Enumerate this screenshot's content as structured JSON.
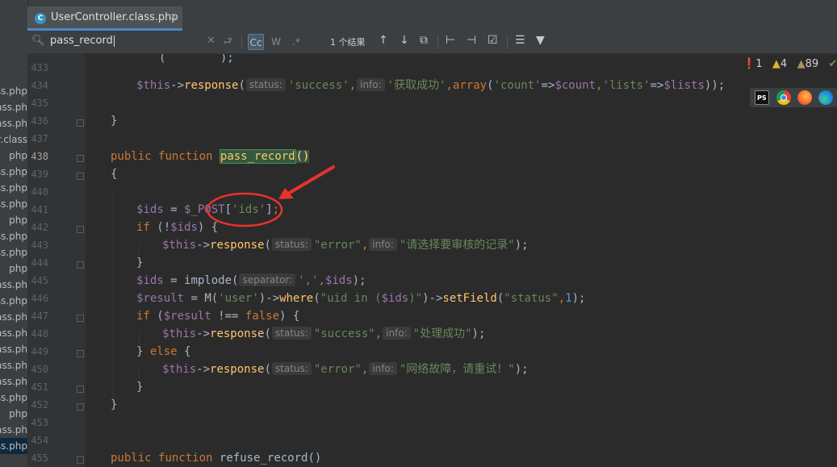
{
  "tab": {
    "title": "UserController.class.php",
    "close": "✕",
    "icon_letter": "C"
  },
  "left_panel": {
    "files": [
      "ass.php",
      "class.ph",
      "class.ph",
      "er.class",
      "php",
      "ass.php",
      "ass.php",
      "ass.php",
      "php",
      "ass.php",
      "ass.php",
      "php",
      "class.ph",
      "ass.php",
      "class.ph",
      "class.ph",
      "class.ph",
      "ass.ph",
      "class.ph",
      "ass.php",
      "php",
      "class.ph",
      "ass.php"
    ]
  },
  "search": {
    "query": "pass_record",
    "match_case": "Cc",
    "words": "W",
    "regex": ".*",
    "result_count": "1 个结果"
  },
  "inspections": {
    "errors": "1",
    "warnings": "4",
    "weak_warnings": "89",
    "icon_error": "❗",
    "icon_warn": "▲"
  },
  "browser_icons": [
    "phpstorm-icon",
    "chrome-icon",
    "firefox-icon",
    "edge-icon"
  ],
  "line_numbers": [
    "433",
    "434",
    "435",
    "436",
    "437",
    "438",
    "439",
    "440",
    "441",
    "442",
    "443",
    "444",
    "445",
    "446",
    "447",
    "448",
    "449",
    "450",
    "451",
    "452",
    "453",
    "454",
    "455"
  ],
  "code": {
    "l434": {
      "this": "$this",
      "arrow": "->",
      "fn": "response",
      "p1": "(",
      "hint1": "status:",
      "s1": "'success'",
      "c1": ",",
      "hint2": "info:",
      "s2": "'获取成功'",
      "c2": ",",
      "arr": "array",
      "p2": "(",
      "s3": "'count'",
      "op1": "=>",
      "v1": "$count",
      "c3": ",",
      "s4": "'lists'",
      "op2": "=>",
      "v2": "$lists",
      "end": "));"
    },
    "l436": {
      "brace": "}"
    },
    "l438": {
      "kw1": "public",
      "kw2": "function",
      "fn": "pass_record",
      "parens": "()"
    },
    "l439": {
      "brace": "{"
    },
    "l441": {
      "v1": "$ids",
      "eq": " = ",
      "v2": "$_POST",
      "b1": "[",
      "s1": "'ids'",
      "b2": "]",
      "semi": ";"
    },
    "l442": {
      "kw": "if",
      "p1": " (!",
      "v": "$ids",
      "p2": ") {"
    },
    "l443": {
      "this": "$this",
      "arrow": "->",
      "fn": "response",
      "p1": "(",
      "hint1": "status:",
      "s1": "\"error\"",
      "c1": ",",
      "hint2": "info:",
      "s2": "\"请选择要审核的记录\"",
      "end": ");"
    },
    "l444": {
      "brace": "}"
    },
    "l445": {
      "v1": "$ids",
      "eq": " = ",
      "fn": "implode",
      "p1": "(",
      "hint1": "separator:",
      "s1": "','",
      "c1": ",",
      "v2": "$ids",
      "end": ");"
    },
    "l446": {
      "v1": "$result",
      "eq": " = ",
      "fn1": "M",
      "p1": "(",
      "s1": "'user'",
      "p2": ")->",
      "fn2": "where",
      "p3": "(",
      "s2": "\"uid in (",
      "v2": "$ids",
      "s3": ")\"",
      "p4": ")->",
      "fn3": "setField",
      "p5": "(",
      "s4": "\"status\"",
      "c1": ",",
      "n1": "1",
      "end": ");"
    },
    "l447": {
      "kw": "if",
      "p1": " (",
      "v": "$result",
      "op": " !== ",
      "kw2": "false",
      "p2": ") {"
    },
    "l448": {
      "this": "$this",
      "arrow": "->",
      "fn": "response",
      "p1": "(",
      "hint1": "status:",
      "s1": "\"success\"",
      "c1": ",",
      "hint2": "info:",
      "s2": "\"处理成功\"",
      "end": ");"
    },
    "l449": {
      "b": "} ",
      "kw": "else",
      "b2": " {"
    },
    "l450": {
      "this": "$this",
      "arrow": "->",
      "fn": "response",
      "p1": "(",
      "hint1": "status:",
      "s1": "\"error\"",
      "c1": ",",
      "hint2": "info:",
      "s2": "\"网络故障，请重试！\"",
      "end": ");"
    },
    "l451": {
      "brace": "}"
    },
    "l452": {
      "brace": "}"
    },
    "l455": {
      "kw1": "public",
      "kw2": "function",
      "fn": "refuse_record",
      "parens": "()"
    }
  },
  "colors": {
    "annotation": "#e8322f",
    "keyword": "#cc7832",
    "string": "#6a8759",
    "variable": "#9876aa"
  }
}
